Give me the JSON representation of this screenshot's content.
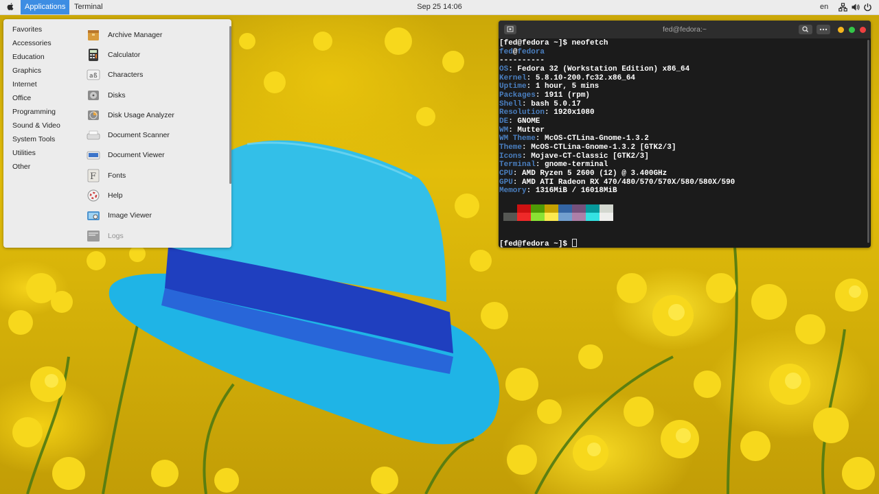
{
  "topbar": {
    "apple_icon": "apple-icon",
    "applications_label": "Applications",
    "terminal_label": "Terminal",
    "clock": "Sep 25  14:06",
    "lang": "en",
    "tray_icons": [
      "network-icon",
      "volume-icon",
      "power-icon"
    ],
    "accent_color": "#3d8de3"
  },
  "app_menu": {
    "categories": [
      "Favorites",
      "Accessories",
      "Education",
      "Graphics",
      "Internet",
      "Office",
      "Programming",
      "Sound & Video",
      "System Tools",
      "Utilities",
      "Other"
    ],
    "apps": [
      {
        "label": "Archive Manager",
        "icon": "archive-manager-icon"
      },
      {
        "label": "Calculator",
        "icon": "calculator-icon"
      },
      {
        "label": "Characters",
        "icon": "characters-icon"
      },
      {
        "label": "Disks",
        "icon": "disks-icon"
      },
      {
        "label": "Disk Usage Analyzer",
        "icon": "disk-usage-analyzer-icon"
      },
      {
        "label": "Document Scanner",
        "icon": "document-scanner-icon"
      },
      {
        "label": "Document Viewer",
        "icon": "document-viewer-icon"
      },
      {
        "label": "Fonts",
        "icon": "fonts-icon"
      },
      {
        "label": "Help",
        "icon": "help-icon"
      },
      {
        "label": "Image Viewer",
        "icon": "image-viewer-icon"
      },
      {
        "label": "Logs",
        "icon": "logs-icon"
      }
    ]
  },
  "terminal": {
    "title": "fed@fedora:~",
    "prompt": "[fed@fedora ~]$ ",
    "command": "neofetch",
    "user": "fed",
    "host": "fedora",
    "separator": "----------",
    "info": [
      {
        "key": "OS",
        "value": "Fedora 32 (Workstation Edition) x86_64"
      },
      {
        "key": "Kernel",
        "value": "5.8.10-200.fc32.x86_64"
      },
      {
        "key": "Uptime",
        "value": "1 hour, 5 mins"
      },
      {
        "key": "Packages",
        "value": "1911 (rpm)"
      },
      {
        "key": "Shell",
        "value": "bash 5.0.17"
      },
      {
        "key": "Resolution",
        "value": "1920x1080"
      },
      {
        "key": "DE",
        "value": "GNOME"
      },
      {
        "key": "WM",
        "value": "Mutter"
      },
      {
        "key": "WM Theme",
        "value": "McOS-CTLina-Gnome-1.3.2"
      },
      {
        "key": "Theme",
        "value": "McOS-CTLina-Gnome-1.3.2 [GTK2/3]"
      },
      {
        "key": "Icons",
        "value": "Mojave-CT-Classic [GTK2/3]"
      },
      {
        "key": "Terminal",
        "value": "gnome-terminal"
      },
      {
        "key": "CPU",
        "value": "AMD Ryzen 5 2600 (12) @ 3.400GHz"
      },
      {
        "key": "GPU",
        "value": "AMD ATI Radeon RX 470/480/570/570X/580/580X/590"
      },
      {
        "key": "Memory",
        "value": "1316MiB / 16018MiB"
      }
    ],
    "palette_dark": [
      "#1b1b1b",
      "#cc1111",
      "#4e9a06",
      "#c4a000",
      "#3465a4",
      "#75507b",
      "#06989a",
      "#d3d7cf"
    ],
    "palette_bright": [
      "#555753",
      "#ef2929",
      "#8ae234",
      "#fce94f",
      "#729fcf",
      "#ad7fa8",
      "#34e2e2",
      "#eeeeec"
    ],
    "label_color": "#4a7fc0",
    "window_buttons": {
      "close": "#ee4040",
      "maximize": "#33c748",
      "minimize": "#f5b51e"
    }
  }
}
